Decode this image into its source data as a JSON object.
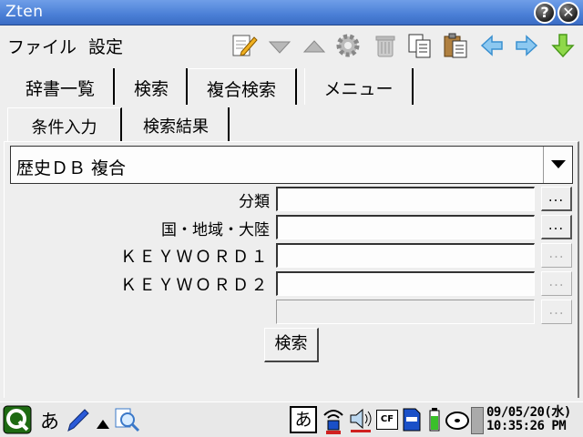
{
  "window": {
    "title": "Zten",
    "help_label": "?",
    "close_label": "✕"
  },
  "menu": {
    "file": "ファイル",
    "settings": "設定"
  },
  "toolbar_icons": [
    "edit-icon",
    "down-triangle-icon",
    "up-triangle-icon",
    "gear-icon",
    "trash-icon",
    "copy-icon",
    "paste-icon",
    "back-arrow-icon",
    "forward-arrow-icon",
    "download-arrow-icon"
  ],
  "tabs": [
    "辞書一覧",
    "検索",
    "複合検索",
    "メニュー"
  ],
  "active_tab": "複合検索",
  "subtabs": [
    "条件入力",
    "検索結果"
  ],
  "dictionary_select": {
    "value": "歴史ＤＢ 複合"
  },
  "fields": [
    {
      "label": "分類",
      "value": "",
      "button": "..."
    },
    {
      "label": "国・地域・大陸",
      "value": "",
      "button": "..."
    },
    {
      "label": "ＫＥＹＷＯＲＤ１",
      "value": "",
      "button": "..."
    },
    {
      "label": "ＫＥＹＷＯＲＤ２",
      "value": "",
      "button": "..."
    },
    {
      "label": "",
      "value": "",
      "button": "..."
    }
  ],
  "search_button": "検索",
  "taskbar": {
    "input_mode": "あ",
    "ime_label": "あ",
    "cf_label": "CF",
    "clock_date": "09/05/20(水)",
    "clock_time": "10:35:26 PM"
  },
  "colors": {
    "titlebar": "#4a7fd6",
    "background": "#eeeeee",
    "arrow_blue": "#4aa0e0",
    "arrow_green": "#5ab82a"
  }
}
